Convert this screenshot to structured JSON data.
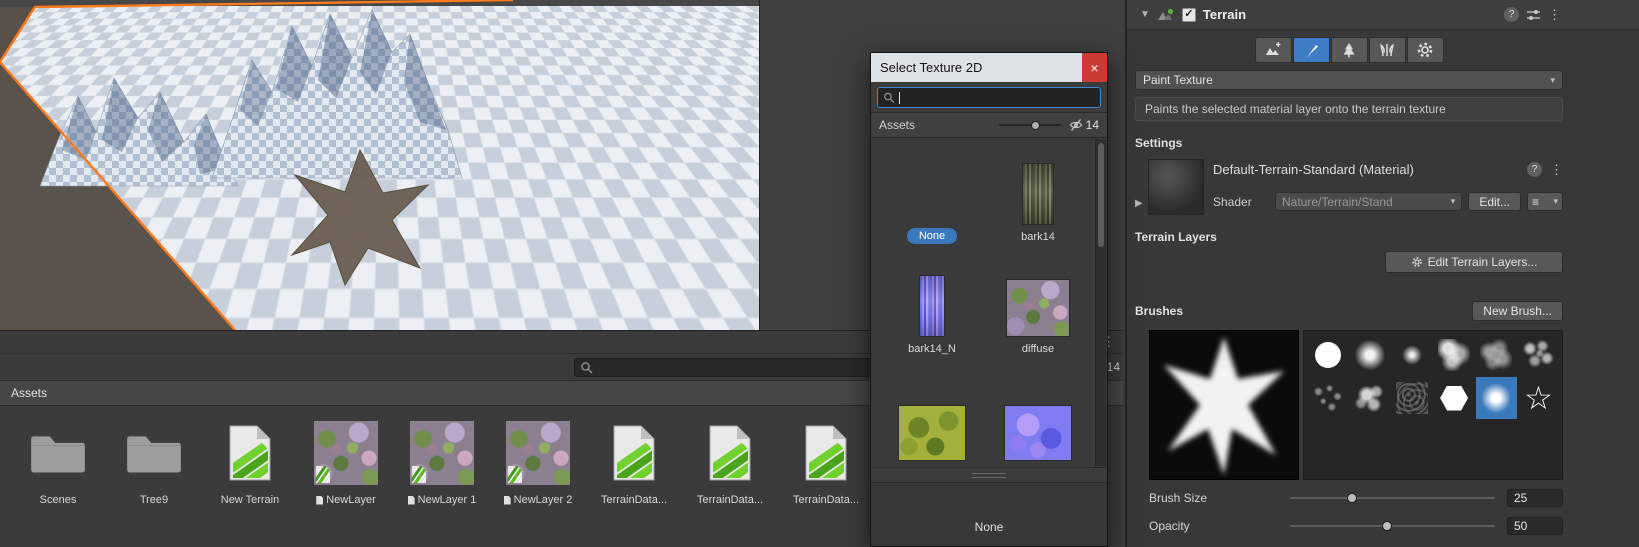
{
  "scene": {
    "selection_outline_color": "#ff7a1a",
    "brush_projection": "star-brush-decal"
  },
  "assets_panel": {
    "header_label": "Assets",
    "hidden_count": "14",
    "search_value": "",
    "items": [
      {
        "label": "Scenes",
        "type": "folder"
      },
      {
        "label": "Tree9",
        "type": "folder"
      },
      {
        "label": "New Terrain",
        "type": "page"
      },
      {
        "label": "NewLayer",
        "type": "layer"
      },
      {
        "label": "NewLayer 1",
        "type": "layer"
      },
      {
        "label": "NewLayer 2",
        "type": "layer"
      },
      {
        "label": "TerrainData...",
        "type": "page"
      },
      {
        "label": "TerrainData...",
        "type": "page"
      },
      {
        "label": "TerrainData...",
        "type": "page"
      }
    ]
  },
  "texture_picker": {
    "title": "Select Texture 2D",
    "close_label": "×",
    "search_value": "",
    "breadcrumb": "Assets",
    "hidden_count": "14",
    "items": [
      {
        "label": "None",
        "kind": "none",
        "selected": true
      },
      {
        "label": "bark14",
        "kind": "bark",
        "selected": false
      },
      {
        "label": "bark14_N",
        "kind": "bark-normal",
        "selected": false
      },
      {
        "label": "diffuse",
        "kind": "diffuse",
        "selected": false
      },
      {
        "label": "",
        "kind": "grass",
        "selected": false
      },
      {
        "label": "",
        "kind": "normal-blob",
        "selected": false
      }
    ],
    "selected_item_label": "None"
  },
  "inspector": {
    "title": "Terrain",
    "accent_color": "#3A79BB",
    "tools": [
      {
        "name": "create-neighbor-terrains"
      },
      {
        "name": "paint-terrain"
      },
      {
        "name": "paint-trees"
      },
      {
        "name": "paint-details"
      },
      {
        "name": "terrain-settings"
      }
    ],
    "selected_tool_index": 1,
    "mode_dropdown_value": "Paint Texture",
    "help_text": "Paints the selected material layer onto the terrain texture",
    "settings_label": "Settings",
    "material": {
      "name": "Default-Terrain-Standard (Material)",
      "shader_label": "Shader",
      "shader_value": "Nature/Terrain/Stand",
      "edit_button_label": "Edit..."
    },
    "terrain_layers_label": "Terrain Layers",
    "edit_terrain_layers_button_label": "Edit Terrain Layers...",
    "brushes_label": "Brushes",
    "new_brush_button_label": "New Brush...",
    "brushes": [
      {
        "name": "circle-solid"
      },
      {
        "name": "circle-soft"
      },
      {
        "name": "dot-soft"
      },
      {
        "name": "blob-mottled"
      },
      {
        "name": "blob-rough"
      },
      {
        "name": "blob-scatter"
      },
      {
        "name": "scatter-faint"
      },
      {
        "name": "splatter"
      },
      {
        "name": "noise-faint"
      },
      {
        "name": "hexagon-solid"
      },
      {
        "name": "square-soft"
      },
      {
        "name": "star-outline"
      }
    ],
    "selected_brush_index": 10,
    "brush_size_label": "Brush Size",
    "brush_size_value": "25",
    "opacity_label": "Opacity",
    "opacity_value": "50"
  }
}
